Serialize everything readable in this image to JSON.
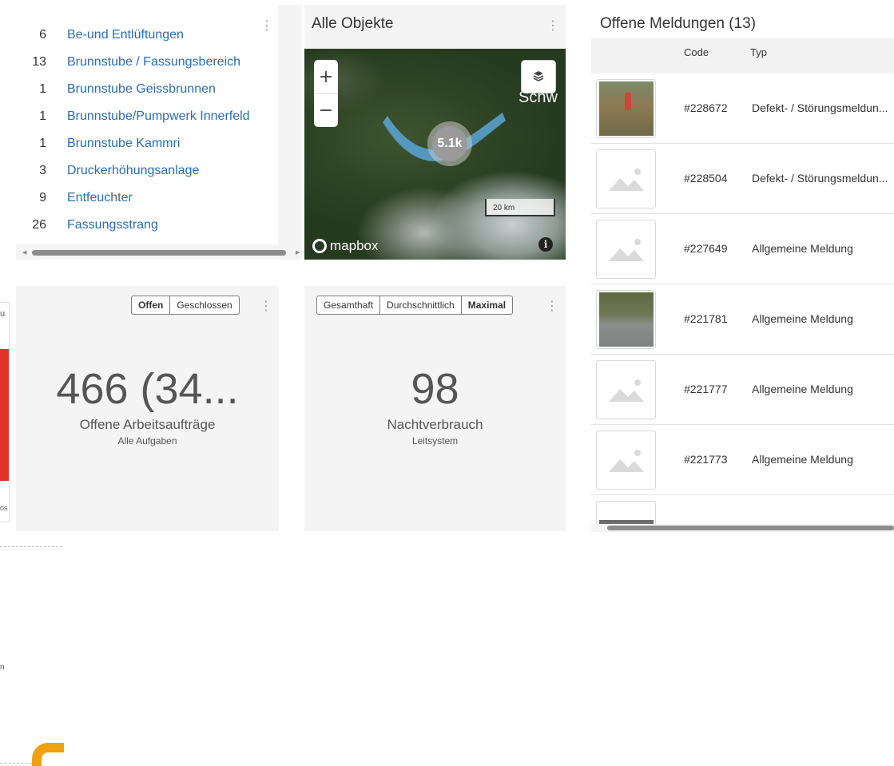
{
  "object_list": {
    "rows": [
      {
        "count": "6",
        "label": "Be-und Entlüftungen"
      },
      {
        "count": "13",
        "label": "Brunnstube / Fassungsbereich"
      },
      {
        "count": "1",
        "label": "Brunnstube Geissbrunnen"
      },
      {
        "count": "1",
        "label": "Brunnstube/Pumpwerk Innerfeld"
      },
      {
        "count": "1",
        "label": "Brunnstube Kammri"
      },
      {
        "count": "3",
        "label": "Druckerhöhungsanlage"
      },
      {
        "count": "9",
        "label": "Entfeuchter"
      },
      {
        "count": "26",
        "label": "Fassungsstrang"
      }
    ]
  },
  "map": {
    "title": "Alle Objekte",
    "zoom_in": "+",
    "zoom_out": "−",
    "layers_icon": "layers-icon",
    "cluster_label": "5.1k",
    "place_label": "Schw",
    "scale_label": "20 km",
    "logo_text": "mapbox",
    "info_label": "i"
  },
  "messages": {
    "title": "Offene Meldungen (13)",
    "col_code": "Code",
    "col_typ": "Typ",
    "rows": [
      {
        "code": "#228672",
        "typ": "Defekt- / Störungsmeldun...",
        "thumb": "photo"
      },
      {
        "code": "#228504",
        "typ": "Defekt- / Störungsmeldun...",
        "thumb": "placeholder"
      },
      {
        "code": "#227649",
        "typ": "Allgemeine Meldung",
        "thumb": "placeholder"
      },
      {
        "code": "#221781",
        "typ": "Allgemeine Meldung",
        "thumb": "photo"
      },
      {
        "code": "#221777",
        "typ": "Allgemeine Meldung",
        "thumb": "placeholder"
      },
      {
        "code": "#221773",
        "typ": "Allgemeine Meldung",
        "thumb": "placeholder"
      }
    ]
  },
  "kpi_work_orders": {
    "toggle_open": "Offen",
    "toggle_closed": "Geschlossen",
    "value": "466 (34...",
    "label": "Offene Arbeitsaufträge",
    "sublabel": "Alle Aufgaben"
  },
  "kpi_night": {
    "toggle_total": "Gesamthaft",
    "toggle_avg": "Durchschnittlich",
    "toggle_max": "Maximal",
    "value": "98",
    "label": "Nachtverbrauch",
    "sublabel": "Leitsystem"
  },
  "edge": {
    "top_text": "u",
    "bottom_text": "os",
    "side_text": "n"
  },
  "colors": {
    "link": "#2a6db0",
    "card_bg": "#f4f4f4",
    "alert_red": "#e0332a",
    "accent_orange": "#f0a010"
  }
}
